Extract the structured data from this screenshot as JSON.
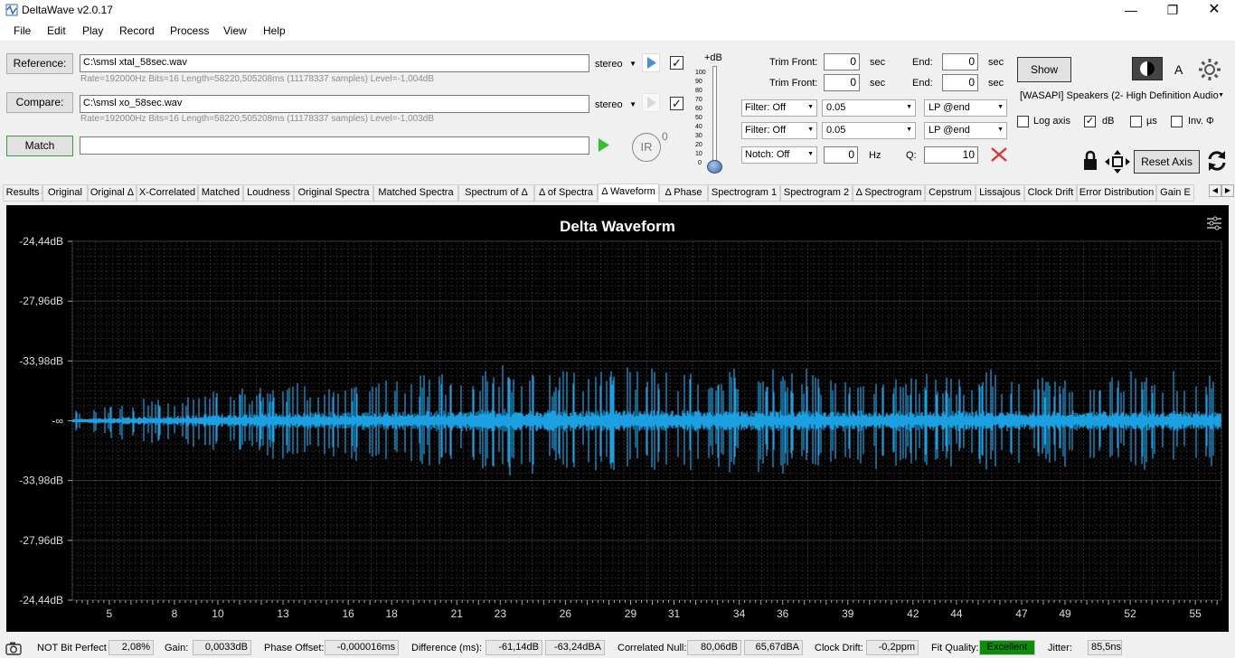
{
  "window": {
    "title": "DeltaWave v2.0.17"
  },
  "menu": [
    "File",
    "Edit",
    "Play",
    "Record",
    "Process",
    "View",
    "Help"
  ],
  "reference": {
    "button": "Reference:",
    "path": "C:\\smsl xtal_58sec.wav",
    "channel": "stereo",
    "info": "Rate=192000Hz Bits=16 Length=58220,505208ms (11178337 samples) Level=-1,004dB",
    "checked": true
  },
  "compare": {
    "button": "Compare:",
    "path": "C:\\smsl xo_58sec.wav",
    "channel": "stereo",
    "info": "Rate=192000Hz Bits=16 Length=58220,505208ms (11178337 samples) Level=-1,003dB",
    "checked": true
  },
  "match": {
    "button": "Match",
    "value": ""
  },
  "ir": {
    "label": "IR",
    "superscript": "0"
  },
  "slider": {
    "title": "+dB",
    "ticks": [
      "100",
      "90",
      "80",
      "70",
      "60",
      "50",
      "40",
      "30",
      "20",
      "10",
      "0"
    ],
    "level": 0
  },
  "trim": {
    "front_label": "Trim Front:",
    "end_label": "End:",
    "unit": "sec",
    "rows": [
      {
        "front": "0",
        "end": "0"
      },
      {
        "front": "0",
        "end": "0"
      }
    ]
  },
  "filters": [
    {
      "label": "Filter: Off",
      "value": "0.05",
      "mode": "LP @end"
    },
    {
      "label": "Filter: Off",
      "value": "0.05",
      "mode": "LP @end"
    }
  ],
  "notch": {
    "label": "Notch: Off",
    "value": "0",
    "unit": "Hz",
    "q_label": "Q:",
    "q_value": "10"
  },
  "show_button": "Show",
  "font_label": "A",
  "device": "[WASAPI] Speakers (2- High Definition Audio",
  "options": [
    {
      "label": "Log axis",
      "checked": false
    },
    {
      "label": "dB",
      "checked": true
    },
    {
      "label": "µs",
      "checked": false
    },
    {
      "label": "Inv. Φ",
      "checked": false
    }
  ],
  "reset_axis": "Reset Axis",
  "tabs": [
    "Results",
    "Original",
    "Original Δ",
    "X-Correlated",
    "Matched",
    "Loudness",
    "Original Spectra",
    "Matched Spectra",
    "Spectrum of Δ",
    "Δ of Spectra",
    "Δ Waveform",
    "Δ Phase",
    "Spectrogram 1",
    "Spectrogram 2",
    "Δ Spectrogram",
    "Cepstrum",
    "Lissajous",
    "Clock Drift",
    "Error Distribution",
    "Gain E"
  ],
  "active_tab": "Δ Waveform",
  "chart_data": {
    "type": "line",
    "title": "Delta Waveform",
    "y_tick_labels": [
      "-24,44dB",
      "-27,96dB",
      "-33,98dB",
      "-∞",
      "-33,98dB",
      "-27,96dB",
      "-24,44dB"
    ],
    "x_tick_labels": [
      "5",
      "8",
      "10",
      "13",
      "16",
      "18",
      "21",
      "23",
      "26",
      "29",
      "31",
      "34",
      "36",
      "39",
      "42",
      "44",
      "47",
      "49",
      "52",
      "55"
    ],
    "x_range": [
      3.3,
      56.2
    ],
    "series_color": "#1ba1e2",
    "background": "#000000",
    "grid": true,
    "envelope": {
      "x": [
        3.3,
        5,
        8,
        10,
        13,
        16,
        18,
        21,
        23,
        26,
        29,
        31,
        34,
        36,
        39,
        42,
        44,
        47,
        49,
        52,
        55,
        56.2
      ],
      "peak": [
        0.06,
        0.1,
        0.16,
        0.2,
        0.24,
        0.27,
        0.28,
        0.31,
        0.34,
        0.32,
        0.33,
        0.31,
        0.32,
        0.31,
        0.3,
        0.3,
        0.31,
        0.3,
        0.29,
        0.3,
        0.3,
        0.3
      ]
    }
  },
  "status": {
    "bit_perfect_label": "NOT Bit Perfect",
    "bit_perfect_value": "2,08%",
    "gain_label": "Gain:",
    "gain_value": "0,0033dB",
    "phase_label": "Phase Offset:",
    "phase_value": "-0,000016ms",
    "diff_label": "Difference (ms):",
    "diff_value1": "-61,14dB",
    "diff_value2": "-63,24dBA",
    "null_label": "Correlated Null:",
    "null_value1": "80,06dB",
    "null_value2": "65,67dBA",
    "drift_label": "Clock Drift:",
    "drift_value": "-0,2ppm",
    "fit_label": "Fit Quality:",
    "fit_value": "Excellent",
    "fit_color": "#0a8f0a",
    "jitter_label": "Jitter:",
    "jitter_value": "85,5ns"
  }
}
